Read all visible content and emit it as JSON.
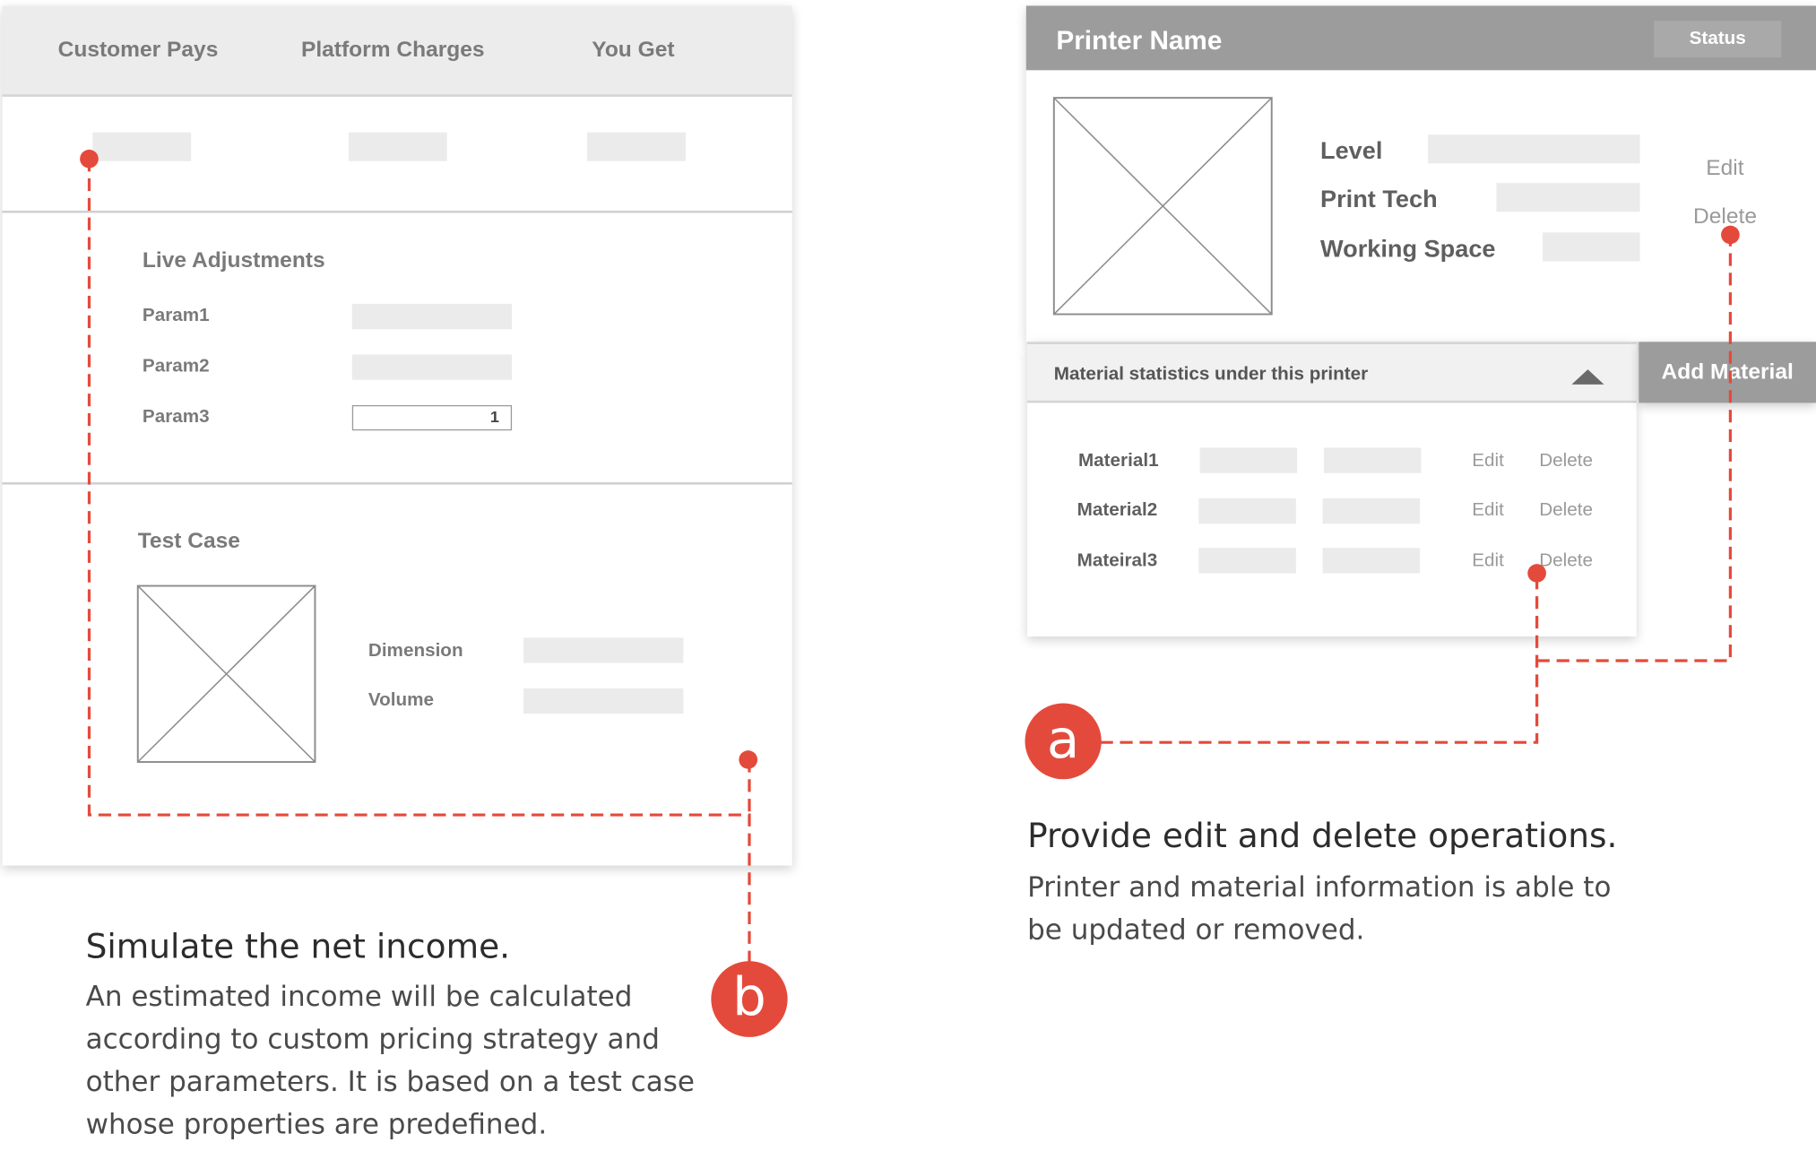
{
  "left_panel": {
    "header": {
      "customer_pays": "Customer Pays",
      "platform_charges": "Platform Charges",
      "you_get": "You Get"
    },
    "live_adjustments": {
      "title": "Live Adjustments",
      "params": [
        "Param1",
        "Param2",
        "Param3"
      ],
      "param3_value": "1"
    },
    "test_case": {
      "title": "Test Case",
      "dimension_label": "Dimension",
      "volume_label": "Volume"
    }
  },
  "right_panel": {
    "printer_name": "Printer Name",
    "status_button": "Status",
    "fields": [
      "Level",
      "Print Tech",
      "Working Space"
    ],
    "edit": "Edit",
    "delete": "Delete",
    "material_bar_title": "Material statistics under this printer",
    "add_material": "Add Material",
    "materials": [
      {
        "name": "Material1",
        "edit": "Edit",
        "delete": "Delete"
      },
      {
        "name": "Material2",
        "edit": "Edit",
        "delete": "Delete"
      },
      {
        "name": "Mateiral3",
        "edit": "Edit",
        "delete": "Delete"
      }
    ]
  },
  "annotation_a": {
    "badge": "a",
    "title": "Provide edit and delete operations.",
    "body": [
      "Printer and material information is able to",
      "be updated or removed."
    ]
  },
  "annotation_b": {
    "badge": "b",
    "title": "Simulate the net income.",
    "body": [
      "An estimated income will be calculated",
      "according to custom pricing strategy and",
      "other parameters. It is based on a test case",
      "whose properties are predefined."
    ]
  },
  "colors": {
    "accent": "#e44a3b",
    "header_gray": "#9c9c9c",
    "placeholder": "#ebebeb"
  }
}
